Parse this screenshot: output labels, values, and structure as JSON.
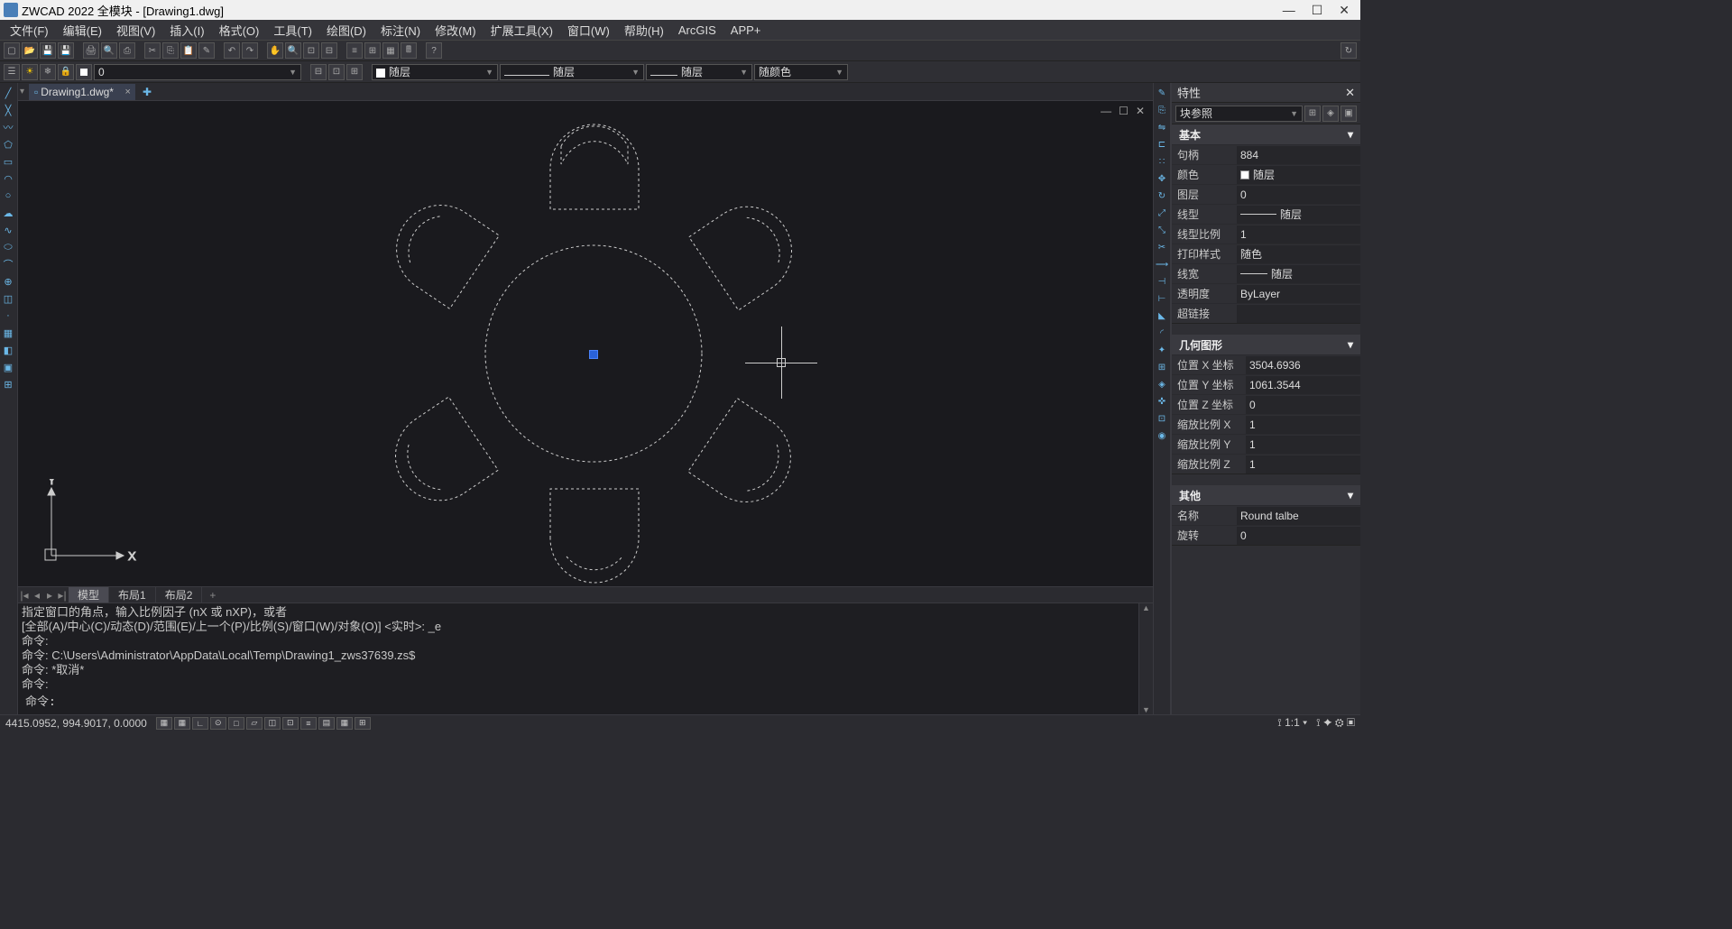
{
  "title": "ZWCAD 2022 全模块 - [Drawing1.dwg]",
  "menu": [
    "文件(F)",
    "编辑(E)",
    "视图(V)",
    "插入(I)",
    "格式(O)",
    "工具(T)",
    "绘图(D)",
    "标注(N)",
    "修改(M)",
    "扩展工具(X)",
    "窗口(W)",
    "帮助(H)",
    "ArcGIS",
    "APP+"
  ],
  "tab_name": "Drawing1.dwg*",
  "layer_combo": "0",
  "linetype_combo": "随层",
  "lineweight_combo": "随层",
  "color_combo": "随颜色",
  "second_row_layer": "随层",
  "layout_tabs": {
    "model": "模型",
    "layout1": "布局1",
    "layout2": "布局2"
  },
  "cmd_history": [
    "指定窗口的角点，输入比例因子 (nX 或 nXP)，或者",
    "[全部(A)/中心(C)/动态(D)/范围(E)/上一个(P)/比例(S)/窗口(W)/对象(O)] <实时>: _e",
    "命令:",
    "命令:  C:\\Users\\Administrator\\AppData\\Local\\Temp\\Drawing1_zws37639.zs$",
    "命令: *取消*",
    "命令:"
  ],
  "cmd_prompt": "命令:",
  "props": {
    "title": "特性",
    "selection": "块参照",
    "basic_hdr": "基本",
    "basic": {
      "handle_l": "句柄",
      "handle_v": "884",
      "color_l": "颜色",
      "color_v": "随层",
      "layer_l": "图层",
      "layer_v": "0",
      "ltype_l": "线型",
      "ltype_v": "随层",
      "ltscale_l": "线型比例",
      "ltscale_v": "1",
      "pstyle_l": "打印样式",
      "pstyle_v": "随色",
      "lweight_l": "线宽",
      "lweight_v": "随层",
      "transp_l": "透明度",
      "transp_v": "ByLayer",
      "hyper_l": "超链接",
      "hyper_v": ""
    },
    "geom_hdr": "几何图形",
    "geom": {
      "posx_l": "位置 X 坐标",
      "posx_v": "3504.6936",
      "posy_l": "位置 Y 坐标",
      "posy_v": "1061.3544",
      "posz_l": "位置 Z 坐标",
      "posz_v": "0",
      "sx_l": "缩放比例 X",
      "sx_v": "1",
      "sy_l": "缩放比例 Y",
      "sy_v": "1",
      "sz_l": "缩放比例 Z",
      "sz_v": "1"
    },
    "other_hdr": "其他",
    "other": {
      "name_l": "名称",
      "name_v": "Round talbe",
      "rot_l": "旋转",
      "rot_v": "0"
    }
  },
  "status": {
    "coords": "4415.0952,  994.9017,  0.0000",
    "scale": "1:1",
    "right1": "▲",
    "right2": "▲"
  }
}
